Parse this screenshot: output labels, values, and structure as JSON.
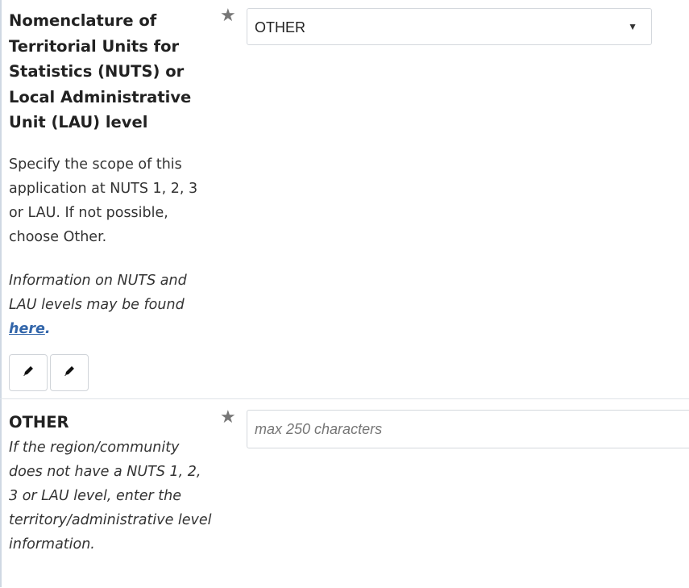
{
  "nuts_field": {
    "title": "Nomenclature of Territorial Units for Statistics (NUTS) or Local Administrative Unit (LAU) level",
    "description": "Specify the scope of this application at NUTS 1, 2, 3 or LAU. If not possible, choose Other.",
    "info_text": "Information on NUTS and LAU levels may be found ",
    "link_text": "here",
    "info_suffix": ".",
    "required_marker": "★",
    "selected_value": "OTHER",
    "caret": "▼",
    "edit_icons": [
      "pencil-icon",
      "pencil-icon"
    ]
  },
  "other_field": {
    "title": "OTHER",
    "description": "If the region/community does not have a NUTS 1, 2, 3 or LAU level, enter the territory/administrative level information.",
    "required_marker": "★",
    "placeholder": "max 250 characters"
  },
  "colors": {
    "link": "#3366aa",
    "star": "#777777",
    "border": "#d4d8dd"
  }
}
